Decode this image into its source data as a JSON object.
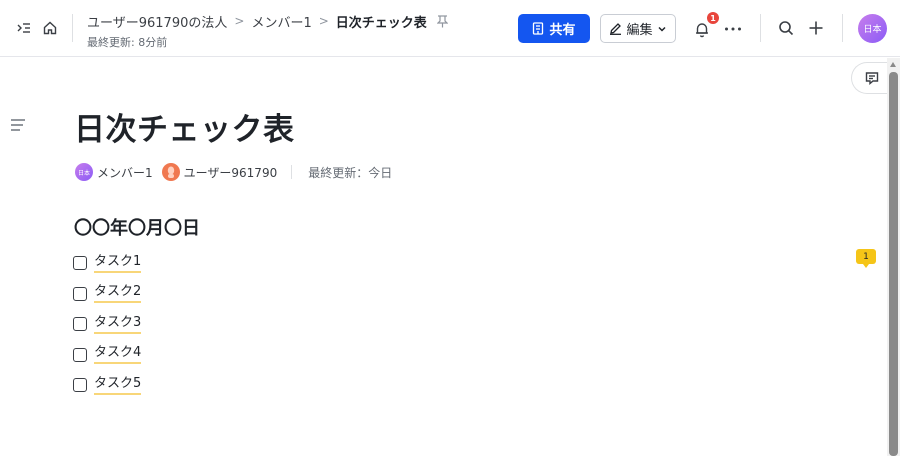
{
  "header": {
    "breadcrumb": [
      {
        "label": "ユーザー961790の法人"
      },
      {
        "label": "メンバー1"
      },
      {
        "label": "日次チェック表"
      }
    ],
    "last_updated": "最終更新: 8分前",
    "share_label": "共有",
    "edit_label": "編集",
    "notification_count": "1",
    "more_label": "···",
    "avatar_text": "日本"
  },
  "document": {
    "title": "日次チェック表",
    "meta": {
      "owner_avatar": "日本",
      "owner_name": "メンバー1",
      "collaborator_name": "ユーザー961790",
      "updated": "最終更新：今日"
    },
    "heading": "〇〇年〇月〇日",
    "tasks": [
      {
        "label": "タスク1",
        "checked": false
      },
      {
        "label": "タスク2",
        "checked": false
      },
      {
        "label": "タスク3",
        "checked": false
      },
      {
        "label": "タスク4",
        "checked": false
      },
      {
        "label": "タスク5",
        "checked": false
      }
    ]
  },
  "comments": {
    "inline_count": "1"
  },
  "colors": {
    "accent": "#1456f0",
    "notification": "#e8453c",
    "comment_marker": "#f5c518",
    "task_underline": "#f8d679"
  }
}
